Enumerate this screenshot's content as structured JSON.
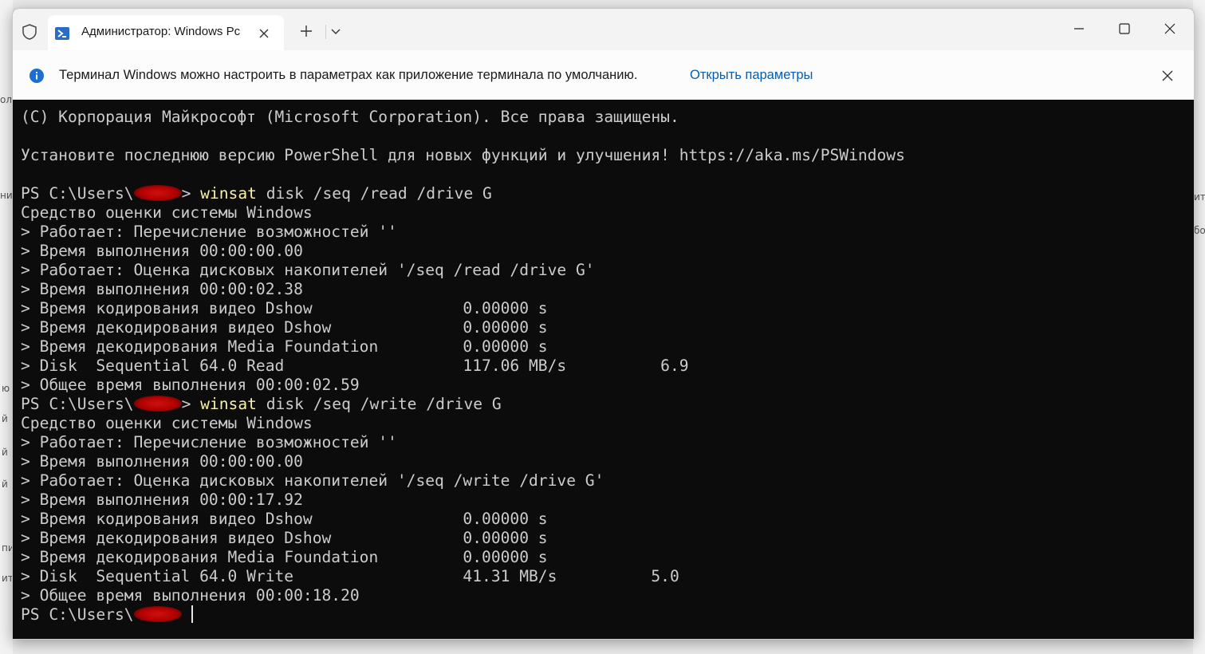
{
  "window": {
    "tab_title": "Администратор: Windows Pc",
    "new_tab_symbol": "+",
    "dropdown_symbol": "⌄"
  },
  "infobar": {
    "message": "Терминал Windows можно настроить в параметрах как приложение терминала по умолчанию.",
    "link": "Открыть параметры"
  },
  "background_fragments": [
    "ол",
    "ни",
    "ите",
    "бо,",
    "ю",
    "й",
    "й",
    "й",
    "пи",
    "ит"
  ],
  "terminal": {
    "lines": [
      {
        "type": "text",
        "text": "(C) Корпорация Майкрософт (Microsoft Corporation). Все права защищены."
      },
      {
        "type": "text",
        "text": ""
      },
      {
        "type": "text",
        "text": "Установите последнюю версию PowerShell для новых функций и улучшения! https://aka.ms/PSWindows"
      },
      {
        "type": "text",
        "text": ""
      },
      {
        "type": "prompt",
        "prefix": "PS C:\\Users\\",
        "suffix": "> ",
        "cmd": "winsat",
        "args": " disk /seq /read /drive G"
      },
      {
        "type": "text",
        "text": "Средство оценки системы Windows"
      },
      {
        "type": "text",
        "text": "> Работает: Перечисление возможностей ''"
      },
      {
        "type": "text",
        "text": "> Время выполнения 00:00:00.00"
      },
      {
        "type": "text",
        "text": "> Работает: Оценка дисковых накопителей '/seq /read /drive G'"
      },
      {
        "type": "text",
        "text": "> Время выполнения 00:00:02.38"
      },
      {
        "type": "text",
        "text": "> Время кодирования видео Dshow                0.00000 s"
      },
      {
        "type": "text",
        "text": "> Время декодирования видео Dshow              0.00000 s"
      },
      {
        "type": "text",
        "text": "> Время декодирования Media Foundation         0.00000 s"
      },
      {
        "type": "text",
        "text": "> Disk  Sequential 64.0 Read                   117.06 MB/s          6.9"
      },
      {
        "type": "text",
        "text": "> Общее время выполнения 00:00:02.59"
      },
      {
        "type": "prompt",
        "prefix": "PS C:\\Users\\",
        "suffix": "> ",
        "cmd": "winsat",
        "args": " disk /seq /write /drive G"
      },
      {
        "type": "text",
        "text": "Средство оценки системы Windows"
      },
      {
        "type": "text",
        "text": "> Работает: Перечисление возможностей ''"
      },
      {
        "type": "text",
        "text": "> Время выполнения 00:00:00.00"
      },
      {
        "type": "text",
        "text": "> Работает: Оценка дисковых накопителей '/seq /write /drive G'"
      },
      {
        "type": "text",
        "text": "> Время выполнения 00:00:17.92"
      },
      {
        "type": "text",
        "text": "> Время кодирования видео Dshow                0.00000 s"
      },
      {
        "type": "text",
        "text": "> Время декодирования видео Dshow              0.00000 s"
      },
      {
        "type": "text",
        "text": "> Время декодирования Media Foundation         0.00000 s"
      },
      {
        "type": "text",
        "text": "> Disk  Sequential 64.0 Write                  41.31 MB/s          5.0"
      },
      {
        "type": "text",
        "text": "> Общее время выполнения 00:00:18.20"
      },
      {
        "type": "prompt",
        "prefix": "PS C:\\Users\\",
        "suffix": "",
        "cmd": "",
        "args": "",
        "cursor": true
      }
    ]
  },
  "colors": {
    "terminal_bg": "#0c0c0c",
    "terminal_fg": "#cccccc",
    "command": "#f9f1a5",
    "link": "#0b5cad",
    "info_icon": "#1a6fd1",
    "redaction": "#c00000"
  }
}
